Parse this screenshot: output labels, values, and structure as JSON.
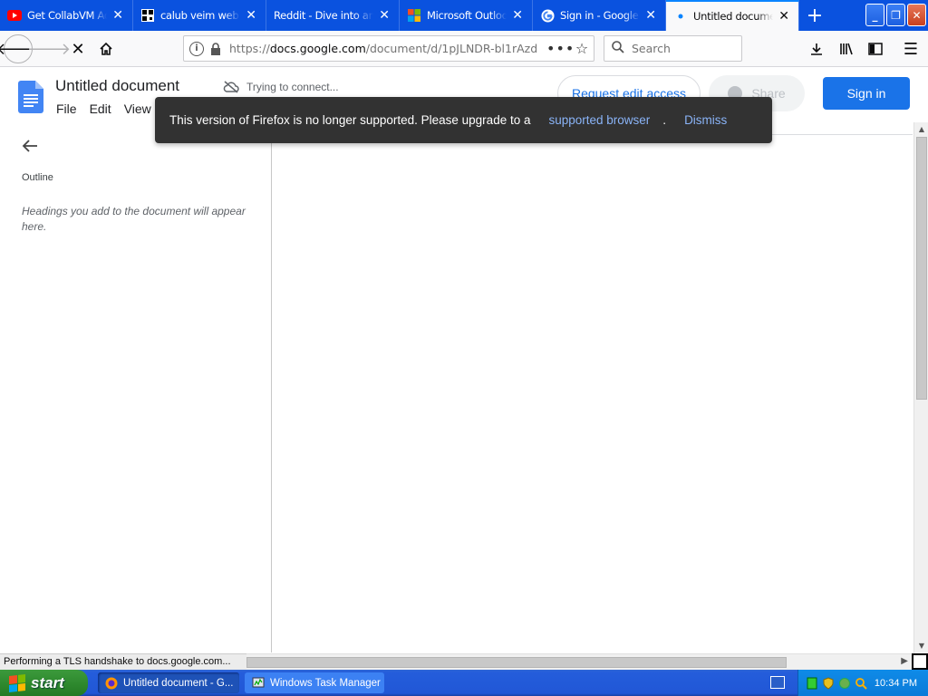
{
  "browser": {
    "tabs": [
      {
        "title": "Get CollabVM Admin",
        "icon": "youtube-icon"
      },
      {
        "title": "calub veim web app",
        "icon": "qr-icon"
      },
      {
        "title": "Reddit - Dive into anything",
        "icon": "none"
      },
      {
        "title": "Microsoft Outlook",
        "icon": "microsoft-icon"
      },
      {
        "title": "Sign in - Google Accounts",
        "icon": "google-icon"
      },
      {
        "title": "Untitled document",
        "icon": "loading-dot-icon",
        "active": true
      }
    ],
    "new_tab": "+",
    "url_prefix": "https://",
    "url_domain": "docs.google.com",
    "url_path": "/document/d/1pJLNDR-bl1rAzd",
    "search_placeholder": "Search"
  },
  "docs": {
    "title": "Untitled document",
    "menu": [
      "File",
      "Edit",
      "View"
    ],
    "connection_status": "Trying to connect...",
    "request_edit": "Request edit access",
    "share": "Share",
    "sign_in": "Sign in",
    "accent": "#1a73e8"
  },
  "outline": {
    "title": "Outline",
    "hint": "Headings you add to the document will appear here."
  },
  "toast": {
    "message": "This version of Firefox is no longer supported. Please upgrade to a",
    "link": "supported browser",
    "period": ".",
    "dismiss": "Dismiss"
  },
  "status_bar": "Performing a TLS handshake to docs.google.com...",
  "taskbar": {
    "start": "start",
    "tasks": [
      {
        "label": "Untitled document - G...",
        "icon": "firefox-icon",
        "active": true
      },
      {
        "label": "Windows Task Manager",
        "icon": "task-manager-icon",
        "active": false
      }
    ],
    "clock": "10:34 PM"
  }
}
